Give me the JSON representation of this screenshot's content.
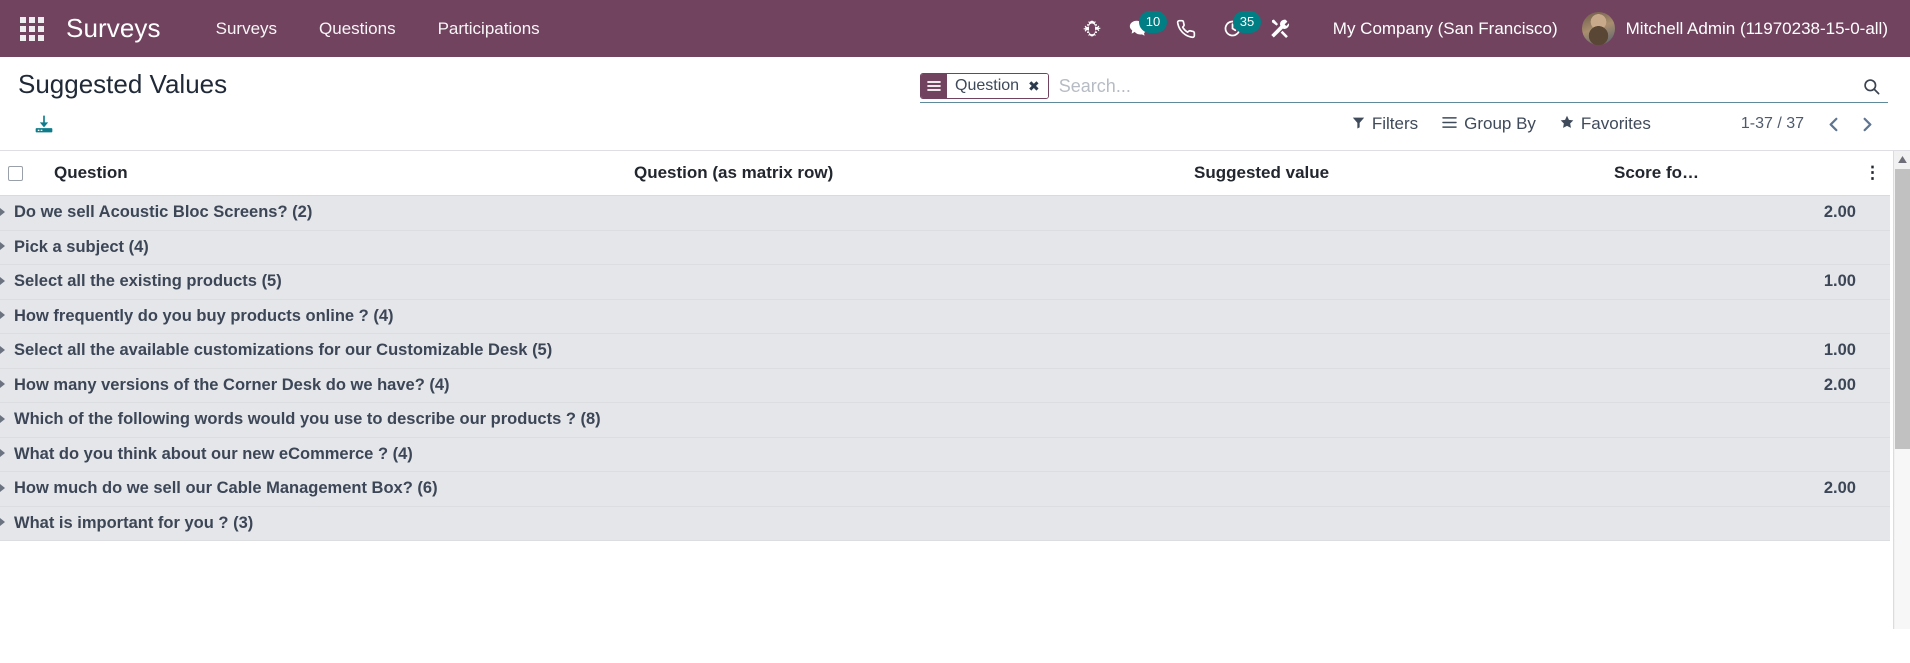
{
  "navbar": {
    "apps_menu_icon": "apps-grid-icon",
    "brand": "Surveys",
    "menu_items": [
      {
        "label": "Surveys"
      },
      {
        "label": "Questions"
      },
      {
        "label": "Participations"
      }
    ],
    "sys_icons": [
      {
        "name": "bug-icon",
        "badge": null
      },
      {
        "name": "messages-icon",
        "badge": "10"
      },
      {
        "name": "phone-icon",
        "badge": null
      },
      {
        "name": "activities-clock-icon",
        "badge": "35"
      },
      {
        "name": "tools-icon",
        "badge": null
      }
    ],
    "company": "My Company (San Francisco)",
    "user": "Mitchell Admin (11970238-15-0-all)",
    "accent_bg": "#71435f",
    "badge_color": "#017e84"
  },
  "control_panel": {
    "title": "Suggested Values",
    "download_icon": "download-icon",
    "search": {
      "facet": {
        "icon": "group-by-icon",
        "label": "Question",
        "close": "✖"
      },
      "placeholder": "Search...",
      "value": "",
      "search_icon": "search-icon"
    },
    "filters": [
      {
        "name": "filters",
        "icon": "filter-funnel-icon",
        "label": "Filters"
      },
      {
        "name": "group-by",
        "icon": "group-by-lines-icon",
        "label": "Group By"
      },
      {
        "name": "favorites",
        "icon": "star-icon",
        "label": "Favorites"
      }
    ],
    "pager": {
      "value": "1-37 / 37",
      "prev_icon": "chevron-left-icon",
      "next_icon": "chevron-right-icon"
    }
  },
  "list": {
    "columns": [
      {
        "key": "check",
        "label": ""
      },
      {
        "key": "question",
        "label": "Question"
      },
      {
        "key": "matrix",
        "label": "Question (as matrix row)"
      },
      {
        "key": "suggested",
        "label": "Suggested value"
      },
      {
        "key": "score",
        "label": "Score fo…"
      },
      {
        "key": "options",
        "label": "⋮"
      }
    ],
    "rows": [
      {
        "question": "Do we sell Acoustic Bloc Screens? (2)",
        "matrix": "",
        "suggested": "",
        "score": "2.00"
      },
      {
        "question": "Pick a subject (4)",
        "matrix": "",
        "suggested": "",
        "score": ""
      },
      {
        "question": "Select all the existing products (5)",
        "matrix": "",
        "suggested": "",
        "score": "1.00"
      },
      {
        "question": "How frequently do you buy products online ? (4)",
        "matrix": "",
        "suggested": "",
        "score": ""
      },
      {
        "question": "Select all the available customizations for our Customizable Desk (5)",
        "matrix": "",
        "suggested": "",
        "score": "1.00"
      },
      {
        "question": "How many versions of the Corner Desk do we have? (4)",
        "matrix": "",
        "suggested": "",
        "score": "2.00"
      },
      {
        "question": "Which of the following words would you use to describe our products ? (8)",
        "matrix": "",
        "suggested": "",
        "score": ""
      },
      {
        "question": "What do you think about our new eCommerce ? (4)",
        "matrix": "",
        "suggested": "",
        "score": ""
      },
      {
        "question": "How much do we sell our Cable Management Box? (6)",
        "matrix": "",
        "suggested": "",
        "score": "2.00"
      },
      {
        "question": "What is important for you ? (3)",
        "matrix": "",
        "suggested": "",
        "score": ""
      }
    ]
  }
}
